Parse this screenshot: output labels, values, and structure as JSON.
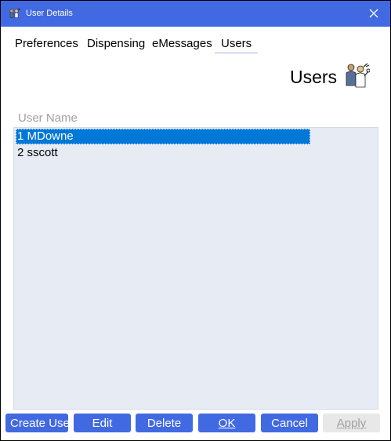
{
  "window": {
    "title": "User Details",
    "close_symbol": "×",
    "colors": {
      "titlebar": "#4169e1",
      "accent": "#0078d7",
      "button": "#4169e1",
      "list_bg": "#e6ebf4"
    }
  },
  "tabs": [
    {
      "label": "Preferences",
      "active": false
    },
    {
      "label": "Dispensing",
      "active": false
    },
    {
      "label": "eMessages",
      "active": false
    },
    {
      "label": "Users",
      "active": true
    }
  ],
  "section": {
    "heading": "Users",
    "icon": "people-with-tools-icon"
  },
  "list": {
    "column_header": "User Name",
    "rows": [
      {
        "label": "1 MDowne",
        "selected": true
      },
      {
        "label": "2 sscott",
        "selected": false
      }
    ]
  },
  "buttons": {
    "create_user": "Create User",
    "edit": "Edit",
    "delete": "Delete",
    "ok": "OK",
    "cancel": "Cancel",
    "apply": "Apply"
  }
}
